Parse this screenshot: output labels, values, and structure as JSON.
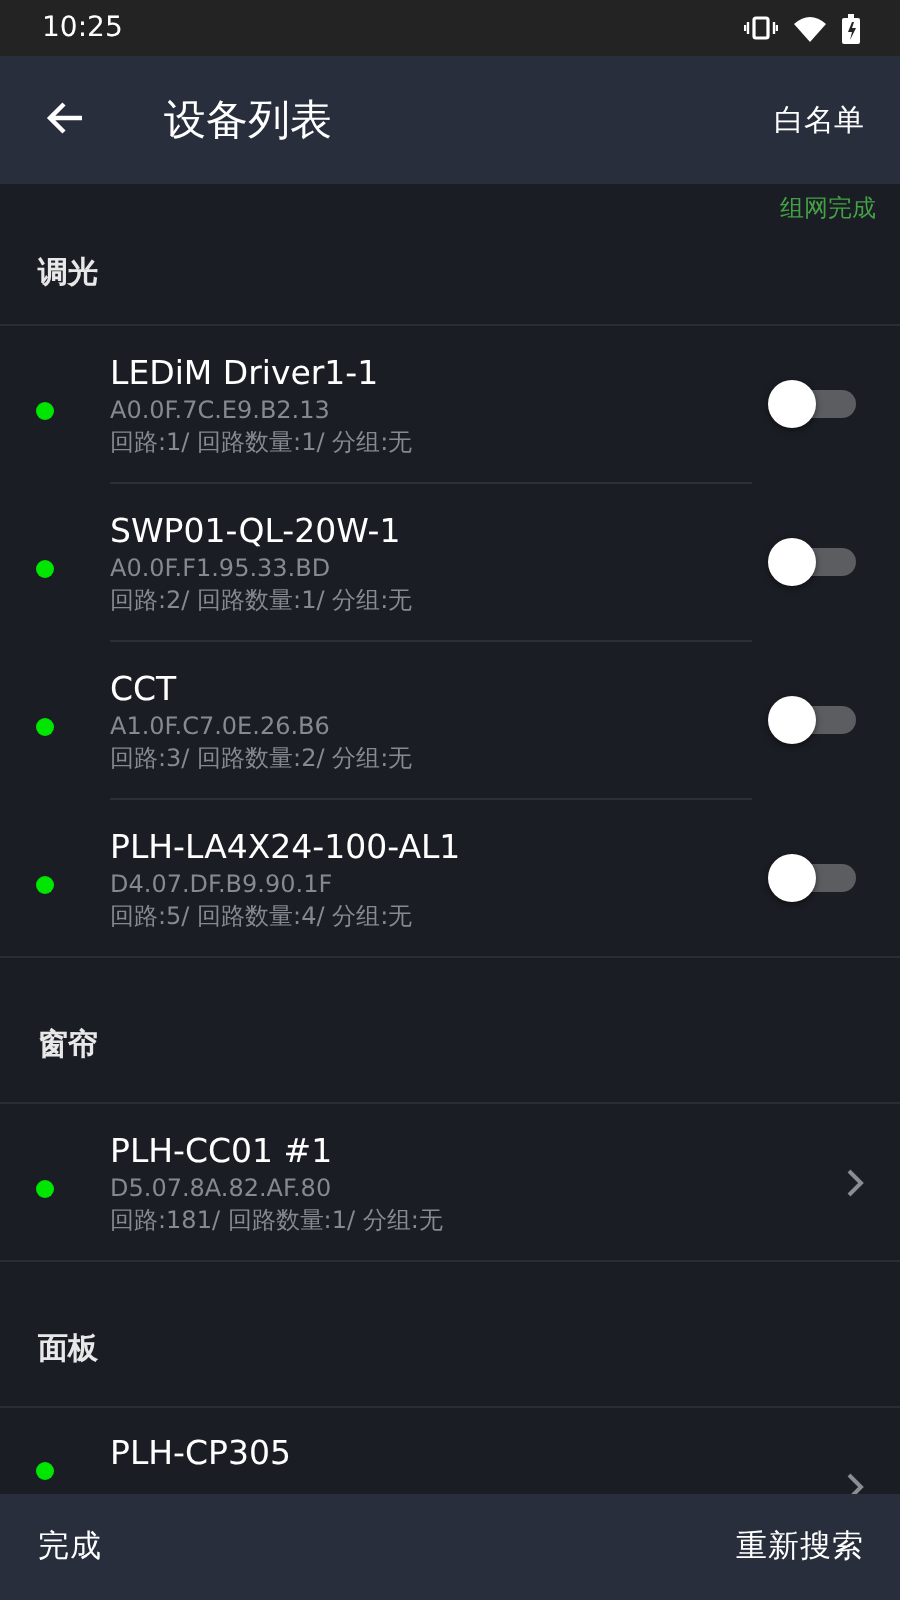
{
  "status_bar": {
    "time": "10:25"
  },
  "app_bar": {
    "title": "设备列表",
    "action": "白名单"
  },
  "network_status": "组网完成",
  "sections": [
    {
      "title": "调光",
      "devices": [
        {
          "kind": "toggle",
          "name": "LEDiM Driver1-1",
          "address": "A0.0F.7C.E9.B2.13",
          "info": "回路:1/ 回路数量:1/ 分组:无",
          "color": "#00e600",
          "on": false
        },
        {
          "kind": "toggle",
          "name": "SWP01-QL-20W-1",
          "address": "A0.0F.F1.95.33.BD",
          "info": "回路:2/ 回路数量:1/ 分组:无",
          "color": "#00e600",
          "on": false
        },
        {
          "kind": "toggle",
          "name": "CCT",
          "address": "A1.0F.C7.0E.26.B6",
          "info": "回路:3/ 回路数量:2/ 分组:无",
          "color": "#00e600",
          "on": false
        },
        {
          "kind": "toggle",
          "name": "PLH-LA4X24-100-AL1",
          "address": "D4.07.DF.B9.90.1F",
          "info": "回路:5/ 回路数量:4/ 分组:无",
          "color": "#00e600",
          "on": false
        }
      ]
    },
    {
      "title": "窗帘",
      "devices": [
        {
          "kind": "link",
          "name": "PLH-CC01 #1",
          "address": "D5.07.8A.82.AF.80",
          "info": "回路:181/ 回路数量:1/ 分组:无",
          "color": "#00e600"
        }
      ]
    },
    {
      "title": "面板",
      "devices": [
        {
          "kind": "link",
          "name": "PLH-CP305",
          "color": "#00e600"
        }
      ]
    }
  ],
  "footer": {
    "left": "完成",
    "right": "重新搜索"
  }
}
